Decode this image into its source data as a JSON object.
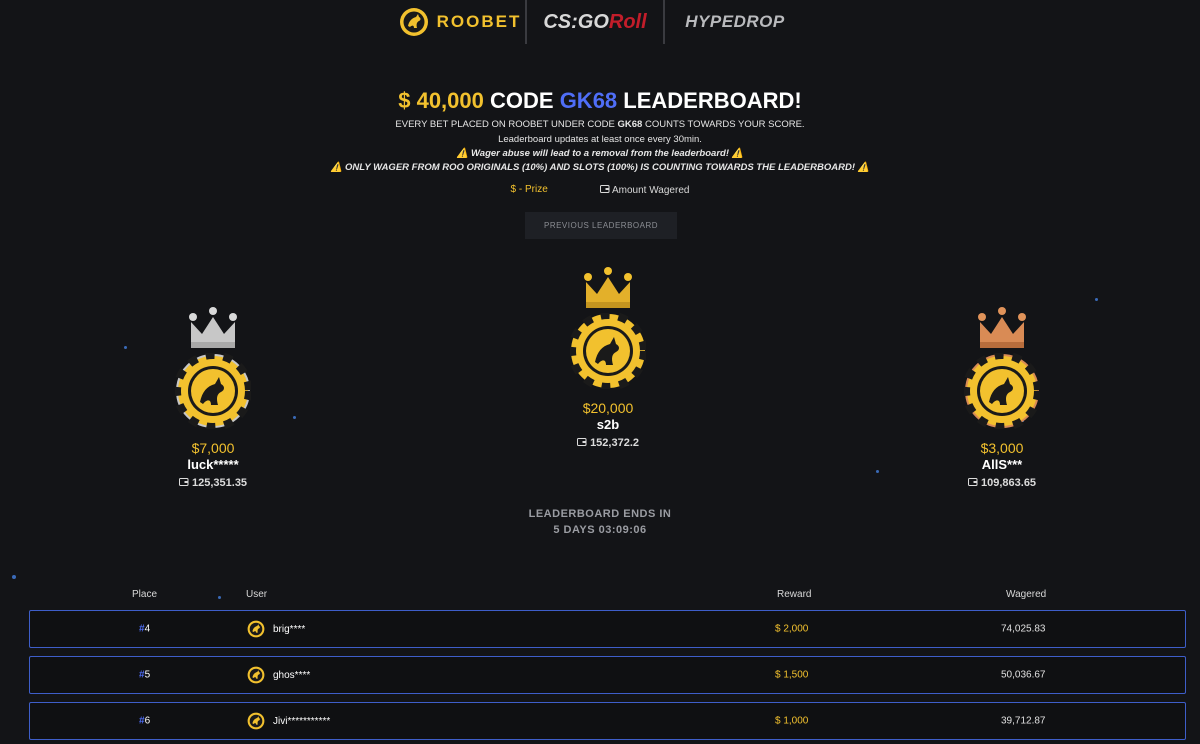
{
  "brands": {
    "roobet": "ROOBET",
    "csgo": "CS:GO",
    "roll": "Roll",
    "hypedrop": "HYPEDROP"
  },
  "header": {
    "title_prize": "$ 40,000",
    "title_code_word": "CODE",
    "title_code": "GK68",
    "title_suffix": "LEADERBOARD!",
    "line1_pre": "EVERY BET PLACED ON ROOBET UNDER CODE",
    "line1_code": "GK68",
    "line1_post": "COUNTS TOWARDS YOUR SCORE.",
    "line2": "Leaderboard updates at least once every 30min.",
    "line3": "Wager abuse will lead to a removal from the leaderboard!",
    "line4": "ONLY WAGER FROM ROO ORIGINALS (10%) AND SLOTS (100%) IS COUNTING TOWARDS THE LEADERBOARD!",
    "warning_glyph": "⚠️"
  },
  "legend": {
    "prize": "$ - Prize",
    "amount": "Amount Wagered"
  },
  "previous_button": "PREVIOUS LEADERBOARD",
  "podium": {
    "first": {
      "prize": "$20,000",
      "name": "s2b",
      "wagered": "152,372.2"
    },
    "second": {
      "prize": "$7,000",
      "name": "luck*****",
      "wagered": "125,351.35"
    },
    "third": {
      "prize": "$3,000",
      "name": "AllS***",
      "wagered": "109,863.65"
    }
  },
  "countdown": {
    "label": "LEADERBOARD ENDS IN",
    "value": "5 DAYS 03:09:06"
  },
  "table": {
    "headers": {
      "place": "Place",
      "user": "User",
      "reward": "Reward",
      "wagered": "Wagered"
    },
    "rows": [
      {
        "hash": "#",
        "place": "4",
        "user": "brig****",
        "reward": "$ 2,000",
        "wagered": "74,025.83"
      },
      {
        "hash": "#",
        "place": "5",
        "user": "ghos****",
        "reward": "$ 1,500",
        "wagered": "50,036.67"
      },
      {
        "hash": "#",
        "place": "6",
        "user": "Jivi***********",
        "reward": "$ 1,000",
        "wagered": "39,712.87"
      }
    ]
  },
  "colors": {
    "accent_gold": "#f2c12e",
    "accent_blue": "#4f6ef7",
    "background": "#131417",
    "row_border": "#3e5ec9",
    "silver": "#d9d9d9",
    "bronze": "#e0935a"
  },
  "icons": {
    "brand": "roobet-kangaroo-icon",
    "crown": "crown-icon",
    "chip": "roobet-chip-icon",
    "wallet": "wallet-icon"
  }
}
